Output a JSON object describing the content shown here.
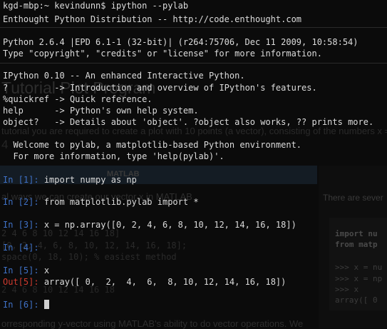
{
  "background_page": {
    "heading": "Tutorial Plot Program",
    "intro": "tutorial you are required to create a plot with 10 points (a vector), consisting of the numbers x =",
    "subhead": "4",
    "table_header": "MATLAB",
    "matlab_text": "al ways we can create our vector x in MATLAB",
    "matlab_code": [
      "2 4 6 8 10 12 14 16 18]",
      "[0, 2, 4, 6, 8, 10, 12, 14, 16, 18];",
      "space(0, 18, 10); % easiest method"
    ],
    "matlab_output": "2     4     6     8    10    12    14    16    18",
    "footer_text": "orresponding y-vector using MATLAB's ability to do vector operations. We",
    "right_panel": {
      "text": "There are sever",
      "code": [
        "import nu",
        "from matp",
        ">>> x = nu",
        ">>> x = np",
        ">>> x",
        "array([ 0"
      ]
    }
  },
  "terminal": {
    "shell_prompt": "kgd-mbp:~ kevindunn$ ipython --pylab",
    "distribution": "Enthought Python Distribution -- http://code.enthought.com",
    "python_version": "Python 2.6.4 |EPD 6.1-1 (32-bit)| (r264:75706, Dec 11 2009, 10:58:54)",
    "python_type_hint": "Type \"copyright\", \"credits\" or \"license\" for more information.",
    "ipython_banner": "IPython 0.10 -- An enhanced Interactive Python.",
    "help_lines": [
      {
        "cmd": "?",
        "pad": "         ",
        "desc": "-> Introduction and overview of IPython's features."
      },
      {
        "cmd": "%quickref",
        "pad": " ",
        "desc": "-> Quick reference."
      },
      {
        "cmd": "help",
        "pad": "      ",
        "desc": "-> Python's own help system."
      },
      {
        "cmd": "object?",
        "pad": "   ",
        "desc": "-> Details about 'object'. ?object also works, ?? prints more."
      }
    ],
    "pylab_welcome": "  Welcome to pylab, a matplotlib-based Python environment.",
    "pylab_help": "  For more information, type 'help(pylab)'.",
    "cells": [
      {
        "prompt": "In [1]:",
        "code": "import numpy as np"
      },
      {
        "prompt": "In [2]:",
        "code": "from matplotlib.pylab import *"
      },
      {
        "prompt": "In [3]:",
        "code": "x = np.array([0, 2, 4, 6, 8, 10, 12, 14, 16, 18])"
      },
      {
        "prompt": "In [4]:",
        "code": ""
      },
      {
        "prompt": "In [5]:",
        "code": "x"
      },
      {
        "prompt": "Out[5]:",
        "code": "array([ 0,  2,  4,  6,  8, 10, 12, 14, 16, 18])"
      },
      {
        "prompt": "In [6]:",
        "code": ""
      }
    ]
  },
  "colors": {
    "in_prompt": "#3f71c6",
    "out_prompt": "#d03b2f",
    "terminal_text": "#dcdcdc",
    "terminal_bg": "#0b0b0b"
  }
}
